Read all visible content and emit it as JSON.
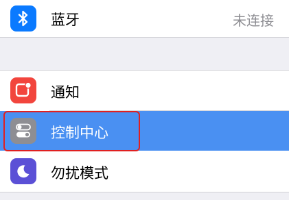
{
  "settings": {
    "bluetooth": {
      "label": "蓝牙",
      "value": "未连接",
      "icon": "bluetooth-icon",
      "icon_color": "#0a7aff"
    },
    "notifications": {
      "label": "通知",
      "icon": "notifications-icon",
      "icon_color": "#f2453d"
    },
    "control_center": {
      "label": "控制中心",
      "icon": "control-center-toggle-icon",
      "icon_color": "#8e8e93",
      "selected": true,
      "highlight_color": "#4a90f2",
      "annotation_color": "#e02020"
    },
    "do_not_disturb": {
      "label": "勿扰模式",
      "icon": "moon-icon",
      "icon_color": "#5b50d6"
    }
  }
}
